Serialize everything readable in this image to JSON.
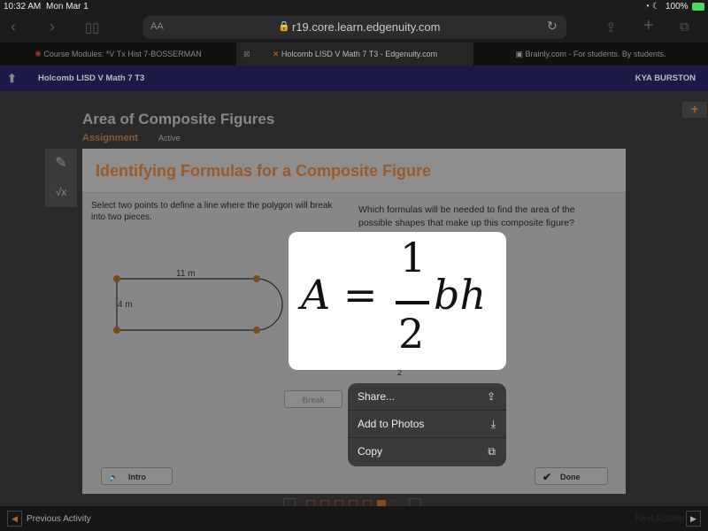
{
  "status": {
    "time": "10:32 AM",
    "date": "Mon Mar 1",
    "battery": "100%"
  },
  "browser": {
    "text_size": "AA",
    "url": "r19.core.learn.edgenuity.com",
    "tabs": [
      {
        "label": "Course Modules: *V Tx Hist 7-BOSSERMAN"
      },
      {
        "label": "Holcomb LISD V Math 7 T3 - Edgenuity.com"
      },
      {
        "label": "Brainly.com - For students. By students."
      }
    ]
  },
  "nav": {
    "course": "Holcomb LISD V Math 7 T3",
    "user": "KYA BURSTON"
  },
  "page": {
    "title": "Area of Composite Figures",
    "type": "Assignment",
    "status": "Active"
  },
  "activity": {
    "title": "Identifying Formulas for a Composite Figure",
    "left_prompt": "Select two points to define a line where the polygon will break into two pieces.",
    "right_prompt": "Which formulas will be needed to find the area of the possible shapes that make up this composite figure?",
    "label_width": "11 m",
    "label_height": "4 m",
    "break_label": "Break",
    "partial_formula": "2",
    "intro_label": "Intro",
    "done_label": "Done"
  },
  "popup": {
    "formula_lhs": "A =",
    "numerator": "1",
    "denominator": "2",
    "formula_rhs": "bh"
  },
  "menu": {
    "items": [
      {
        "label": "Share..."
      },
      {
        "label": "Add to Photos"
      },
      {
        "label": "Copy"
      }
    ]
  },
  "pager": {
    "total": 7,
    "current": 6
  },
  "footer": {
    "prev": "Previous Activity",
    "next": "Next Activity"
  },
  "colors": {
    "accent": "#b0652a",
    "nav": "#1d1947"
  }
}
